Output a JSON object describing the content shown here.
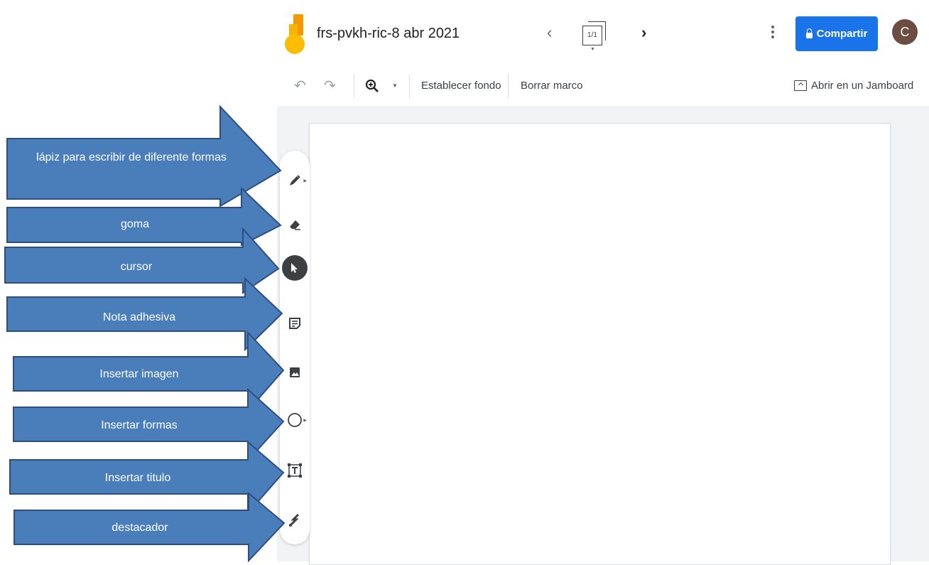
{
  "header": {
    "doc_title": "frs-pvkh-ric-8 abr 2021",
    "frame_counter": "1/1",
    "share_label": "Compartir",
    "avatar_initial": "C",
    "prev_frame_icon": "chevron-left-icon",
    "next_frame_icon": "chevron-right-icon",
    "more_icon": "more-vert-icon"
  },
  "toolbar": {
    "undo_icon": "undo-icon",
    "redo_icon": "redo-icon",
    "zoom_icon": "zoom-in-icon",
    "set_background": "Establecer fondo",
    "clear_frame": "Borrar marco",
    "open_in_jamboard": "Abrir en un Jamboard"
  },
  "tools": [
    {
      "name": "pen",
      "icon": "pen-icon",
      "annotation": "lápiz para escribir de diferente formas"
    },
    {
      "name": "eraser",
      "icon": "eraser-icon",
      "annotation": "goma"
    },
    {
      "name": "select",
      "icon": "cursor-icon",
      "annotation": "cursor"
    },
    {
      "name": "sticky-note",
      "icon": "sticky-note-icon",
      "annotation": "Nota adhesiva"
    },
    {
      "name": "image",
      "icon": "image-icon",
      "annotation": "Insertar imagen"
    },
    {
      "name": "shape",
      "icon": "circle-shape-icon",
      "annotation": "Insertar formas"
    },
    {
      "name": "text-box",
      "icon": "text-box-icon",
      "annotation": "Insertar titulo"
    },
    {
      "name": "laser",
      "icon": "laser-icon",
      "annotation": "destacador"
    }
  ],
  "colors": {
    "share_button": "#1a73e8",
    "avatar": "#6d4c41",
    "callout_fill": "#4a7ebb",
    "callout_stroke": "#2e4e7e",
    "canvas_background": "#f1f3f4"
  }
}
